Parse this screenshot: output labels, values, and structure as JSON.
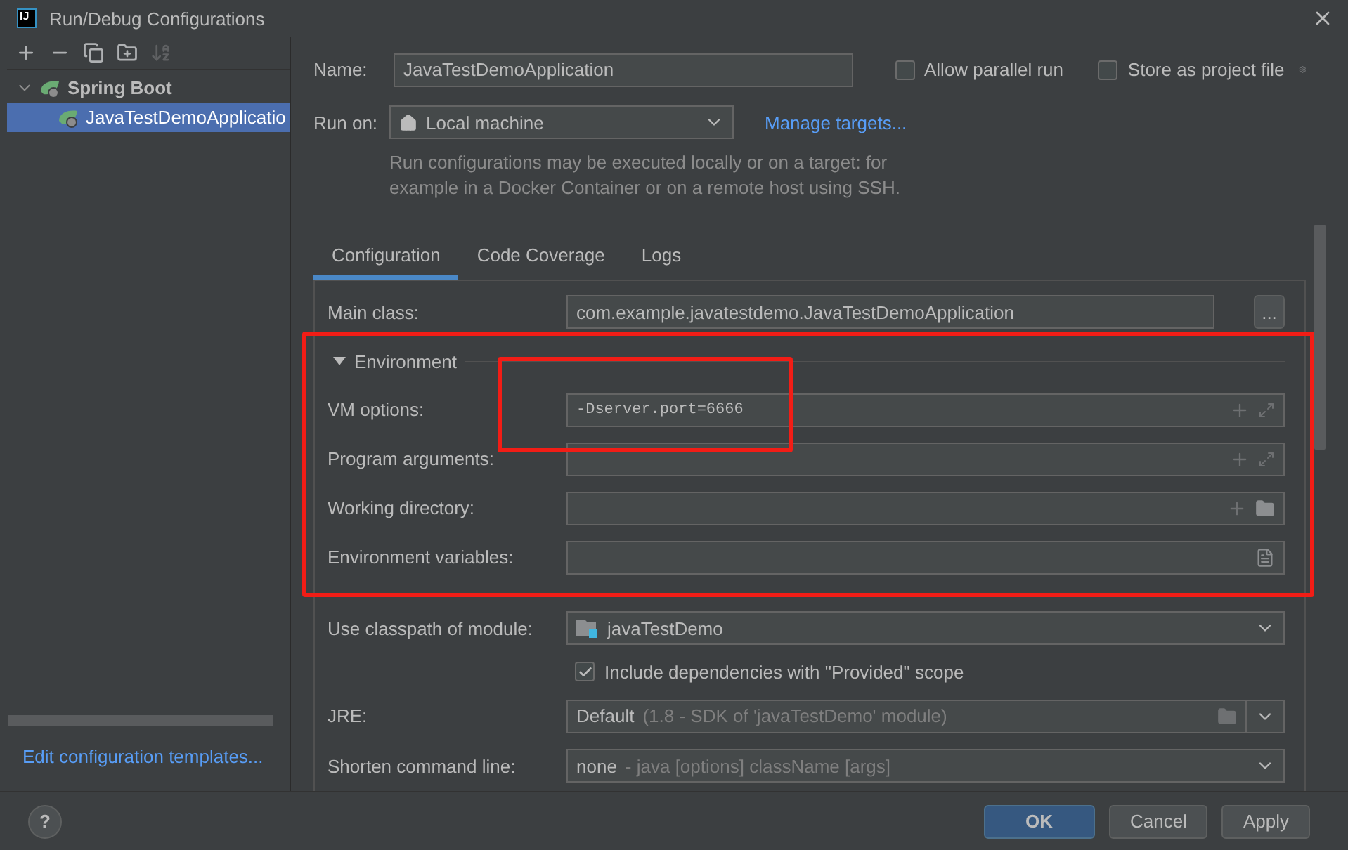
{
  "window": {
    "logo": "IJ",
    "title": "Run/Debug Configurations"
  },
  "toolbar": [
    {
      "kind": "add",
      "disabled": false
    },
    {
      "kind": "remove",
      "disabled": false
    },
    {
      "kind": "copy",
      "disabled": false
    },
    {
      "kind": "folder",
      "disabled": false
    },
    {
      "kind": "sort",
      "disabled": true
    }
  ],
  "tree": [
    {
      "label": "Spring Boot",
      "expanded": true,
      "selected": false,
      "children": [
        {
          "label": "JavaTestDemoApplicatio",
          "selected": true
        }
      ]
    }
  ],
  "templates_link": "Edit configuration templates...",
  "name": {
    "label": "Name:",
    "value": "JavaTestDemoApplication"
  },
  "options": [
    {
      "label": "Allow parallel run",
      "checked": false
    },
    {
      "label": "Store as project file",
      "checked": false
    }
  ],
  "run_on": {
    "label": "Run on:",
    "value": "Local machine",
    "link": "Manage targets..."
  },
  "description": "Run configurations may be executed locally or on a target: for example in a Docker Container or on a remote host using SSH.",
  "tabs": [
    {
      "label": "Configuration",
      "selected": true
    },
    {
      "label": "Code Coverage",
      "selected": false
    },
    {
      "label": "Logs",
      "selected": false
    }
  ],
  "main_class": {
    "label": "Main class:",
    "value": "com.example.javatestdemo.JavaTestDemoApplication",
    "button": "..."
  },
  "environment": {
    "label": "Environment",
    "expanded": true,
    "fields": [
      {
        "label": "VM options:",
        "value": "-Dserver.port=6666",
        "kind": "expand"
      },
      {
        "label": "Program arguments:",
        "kind": "expand"
      },
      {
        "label": "Working directory:",
        "kind": "directory"
      },
      {
        "label": "Environment variables:",
        "kind": "variables"
      }
    ]
  },
  "module": {
    "label": "Use classpath of module:",
    "value": "javaTestDemo"
  },
  "include_provided": {
    "label": "Include dependencies with \"Provided\" scope",
    "checked": true
  },
  "jre": {
    "label": "JRE:",
    "value": "Default",
    "detail": "(1.8 - SDK of 'javaTestDemo' module)"
  },
  "shorten": {
    "label": "Shorten command line:",
    "value": "none",
    "detail": "- java [options] className [args]"
  },
  "help": "?",
  "buttons": [
    {
      "label": "OK",
      "kind": "primary"
    },
    {
      "label": "Cancel",
      "kind": "normal"
    },
    {
      "label": "Apply",
      "kind": "normal"
    }
  ],
  "annotations": [
    {
      "kind": "frame"
    },
    {
      "kind": "frame"
    }
  ]
}
